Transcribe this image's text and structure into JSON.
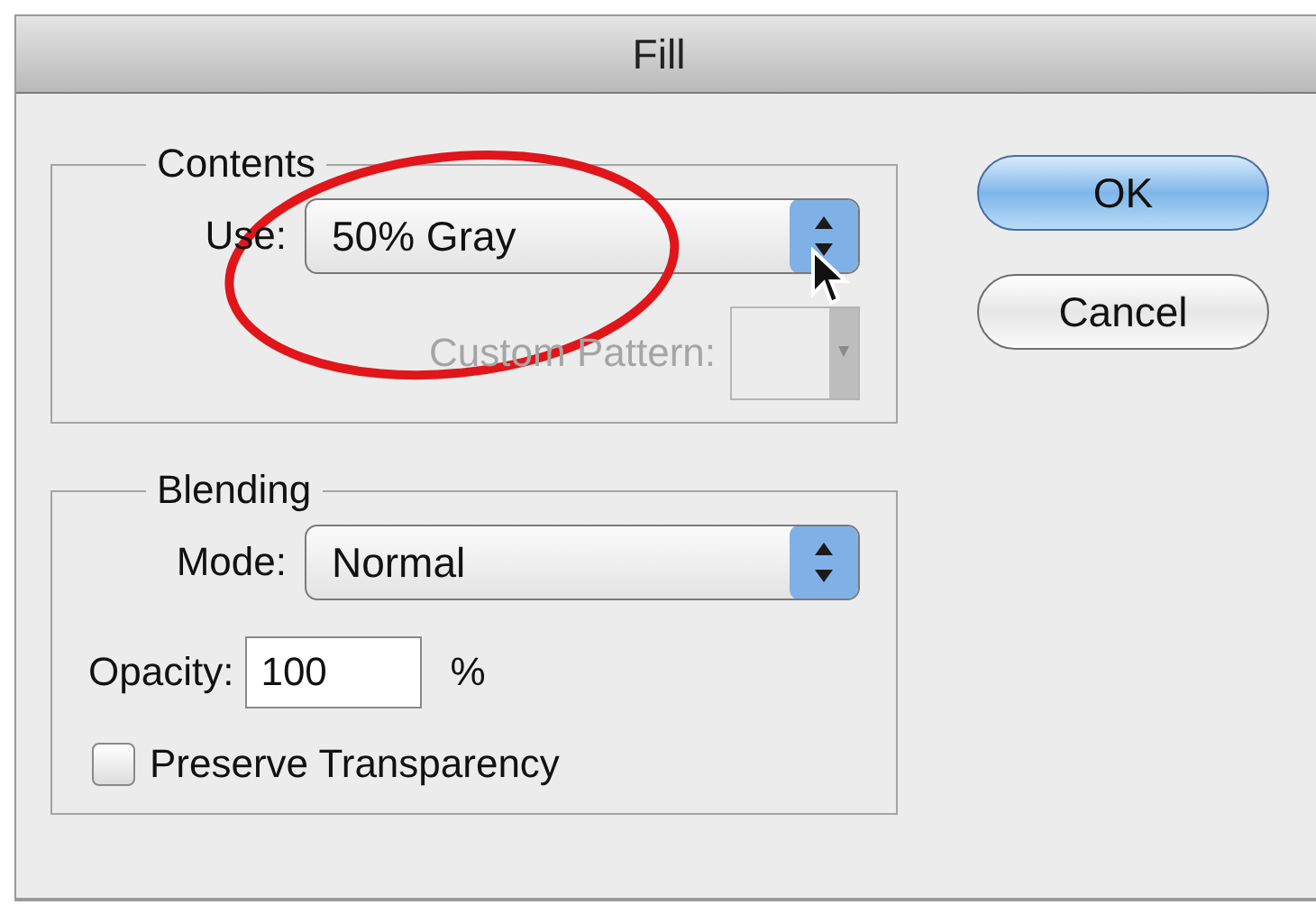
{
  "window": {
    "title": "Fill"
  },
  "contents": {
    "label": "Contents",
    "use": {
      "label": "Use:",
      "value": "50% Gray"
    },
    "custom_pattern": {
      "label": "Custom Pattern:",
      "disabled": true
    }
  },
  "blending": {
    "label": "Blending",
    "mode": {
      "label": "Mode:",
      "value": "Normal"
    },
    "opacity": {
      "label": "Opacity:",
      "value": "100",
      "unit": "%"
    },
    "preserve_transparency": {
      "label": "Preserve Transparency",
      "checked": false
    }
  },
  "buttons": [
    {
      "label": "OK",
      "default": true
    },
    {
      "label": "Cancel",
      "default": false
    }
  ]
}
